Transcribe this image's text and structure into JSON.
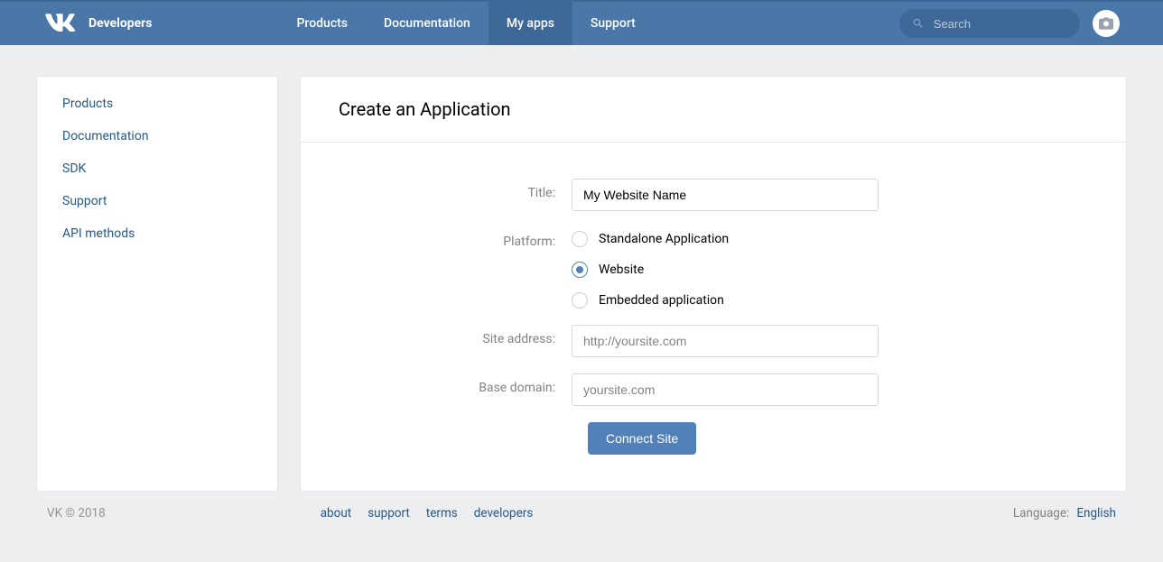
{
  "header": {
    "brand": "Developers",
    "nav": [
      {
        "label": "Products",
        "active": false
      },
      {
        "label": "Documentation",
        "active": false
      },
      {
        "label": "My apps",
        "active": true
      },
      {
        "label": "Support",
        "active": false
      }
    ],
    "search_placeholder": "Search"
  },
  "sidebar": {
    "items": [
      {
        "label": "Products"
      },
      {
        "label": "Documentation"
      },
      {
        "label": "SDK"
      },
      {
        "label": "Support"
      },
      {
        "label": "API methods"
      }
    ]
  },
  "main": {
    "title": "Create an Application",
    "form": {
      "title_label": "Title:",
      "title_value": "My Website Name",
      "platform_label": "Platform:",
      "platform_options": [
        {
          "label": "Standalone Application",
          "selected": false
        },
        {
          "label": "Website",
          "selected": true
        },
        {
          "label": "Embedded application",
          "selected": false
        }
      ],
      "site_address_label": "Site address:",
      "site_address_placeholder": "http://yoursite.com",
      "site_address_value": "",
      "base_domain_label": "Base domain:",
      "base_domain_placeholder": "yoursite.com",
      "base_domain_value": "",
      "submit_label": "Connect Site"
    }
  },
  "footer": {
    "copyright": "VK © 2018",
    "links": [
      {
        "label": "about"
      },
      {
        "label": "support"
      },
      {
        "label": "terms"
      },
      {
        "label": "developers"
      }
    ],
    "language_label": "Language:",
    "language_value": "English"
  }
}
